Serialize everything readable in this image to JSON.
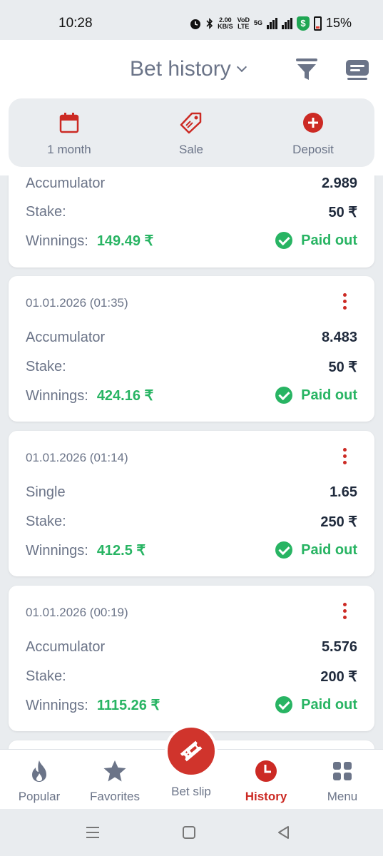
{
  "status_bar": {
    "time": "10:28",
    "net_speed_top": "2.00",
    "net_speed_bottom": "KB/S",
    "volte_top": "VoD",
    "volte_bottom": "LTE",
    "net_type": "5G",
    "battery": "15%"
  },
  "header": {
    "title": "Bet history"
  },
  "quick_actions": [
    {
      "label": "1 month",
      "icon": "calendar-icon"
    },
    {
      "label": "Sale",
      "icon": "tag-icon"
    },
    {
      "label": "Deposit",
      "icon": "plus-circle-icon"
    }
  ],
  "bets": [
    {
      "date": "",
      "type": "Accumulator",
      "odds": "2.989",
      "stake_label": "Stake:",
      "stake": "50 ₹",
      "winnings_label": "Winnings:",
      "winnings": "149.49 ₹",
      "status": "Paid out"
    },
    {
      "date": "01.01.2026 (01:35)",
      "type": "Accumulator",
      "odds": "8.483",
      "stake_label": "Stake:",
      "stake": "50 ₹",
      "winnings_label": "Winnings:",
      "winnings": "424.16 ₹",
      "status": "Paid out"
    },
    {
      "date": "01.01.2026 (01:14)",
      "type": "Single",
      "odds": "1.65",
      "stake_label": "Stake:",
      "stake": "250 ₹",
      "winnings_label": "Winnings:",
      "winnings": "412.5 ₹",
      "status": "Paid out"
    },
    {
      "date": "01.01.2026 (00:19)",
      "type": "Accumulator",
      "odds": "5.576",
      "stake_label": "Stake:",
      "stake": "200 ₹",
      "winnings_label": "Winnings:",
      "winnings": "1115.26 ₹",
      "status": "Paid out"
    }
  ],
  "bottom_nav": [
    {
      "label": "Popular",
      "icon": "flame-icon"
    },
    {
      "label": "Favorites",
      "icon": "star-icon"
    },
    {
      "label": "Bet slip",
      "icon": "ticket-icon"
    },
    {
      "label": "History",
      "icon": "clock-icon"
    },
    {
      "label": "Menu",
      "icon": "grid-icon"
    }
  ],
  "colors": {
    "accent_red": "#cc2a24",
    "success_green": "#28b463",
    "muted_text": "#6b7488"
  }
}
